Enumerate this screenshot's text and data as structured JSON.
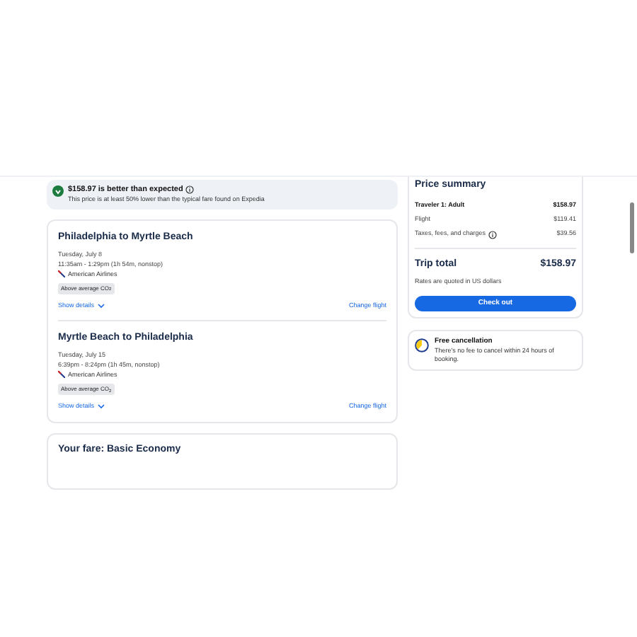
{
  "banner": {
    "title": "$158.97 is better than expected",
    "subtitle": "This price is at least 50% lower than the typical fare found on Expedia"
  },
  "flights": [
    {
      "route": "Philadelphia to Myrtle Beach",
      "date": "Tuesday, July 8",
      "times": "11:35am - 1:29pm (1h 54m, nonstop)",
      "airline": "American Airlines",
      "tag": "Above average CO$_{2}$",
      "details": "Show details",
      "change": "Change flight"
    },
    {
      "route": "Myrtle Beach to Philadelphia",
      "date": "Tuesday, July 15",
      "times": "6:39pm - 8:24pm (1h 45m, nonstop)",
      "airline": "American Airlines",
      "tag": "Above average CO$_{2}$",
      "details": "Show details",
      "change": "Change flight"
    }
  ],
  "fare": {
    "title": "Your fare: Basic Economy"
  },
  "summary": {
    "title": "Price summary",
    "lines": [
      {
        "label": "Traveler 1: Adult",
        "value": "$158.97",
        "bold": true,
        "info": false
      },
      {
        "label": "Flight",
        "value": "$119.41",
        "bold": false,
        "info": false
      },
      {
        "label": "Taxes, fees, and charges",
        "value": "$39.56",
        "bold": false,
        "info": true
      }
    ],
    "total_label": "Trip total",
    "total": "$158.97",
    "note": "Rates are quoted in US dollars",
    "button": "Check out"
  },
  "cancellation": {
    "title": "Free cancellation",
    "text": "There's no fee to cancel within 24 hours of booking."
  }
}
